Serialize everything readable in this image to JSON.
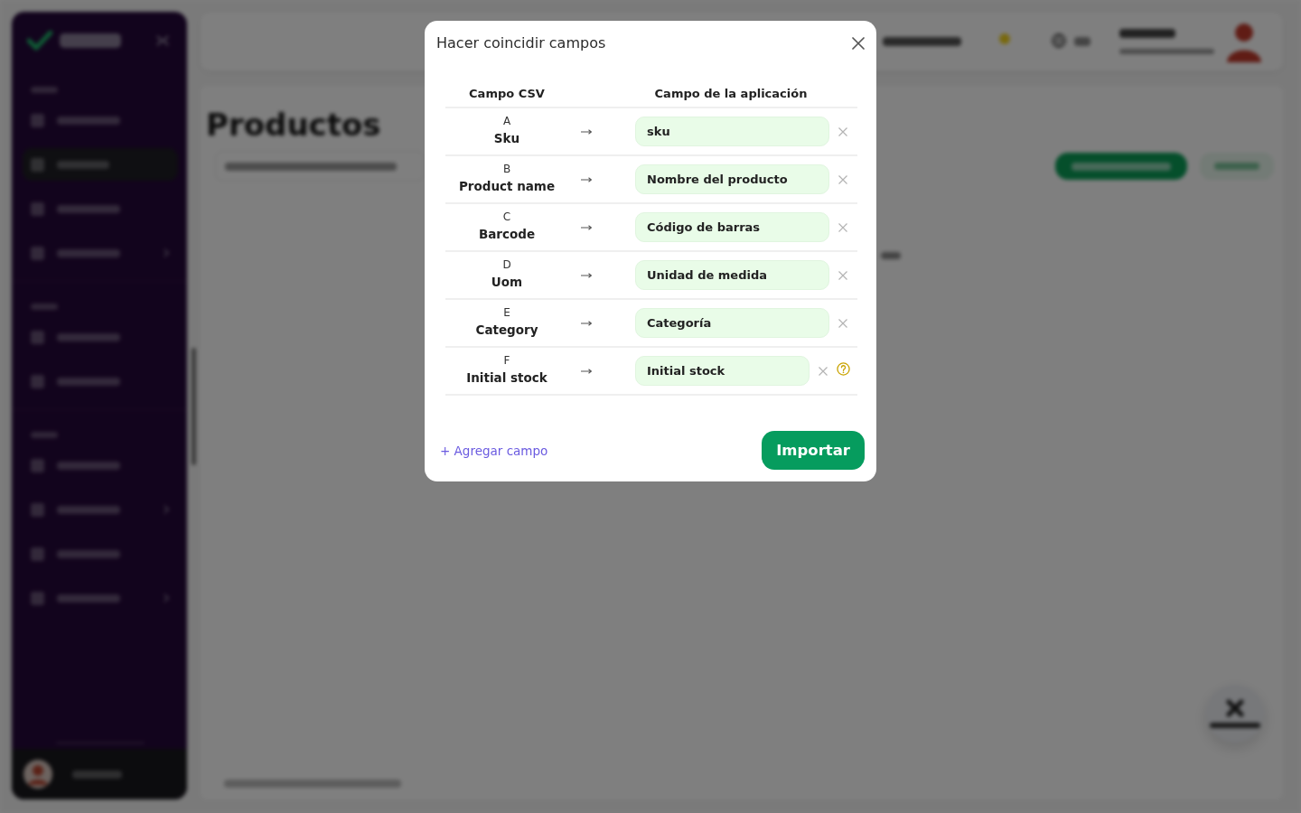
{
  "sidebar": {
    "sections": [
      {
        "items": [
          {
            "selected": false,
            "submenu": false
          },
          {
            "selected": true,
            "submenu": false
          },
          {
            "selected": false,
            "submenu": false
          },
          {
            "selected": false,
            "submenu": true
          }
        ]
      },
      {
        "items": [
          {
            "selected": false,
            "submenu": false
          },
          {
            "selected": false,
            "submenu": false
          }
        ]
      },
      {
        "items": [
          {
            "selected": false,
            "submenu": false
          },
          {
            "selected": false,
            "submenu": true
          },
          {
            "selected": false,
            "submenu": false
          },
          {
            "selected": false,
            "submenu": true
          }
        ]
      }
    ]
  },
  "page": {
    "title": "Productos"
  },
  "dialog": {
    "title": "Hacer coincidir campos",
    "columns": [
      "Campo CSV",
      "Campo de la aplicación"
    ],
    "mappings": [
      {
        "letter": "A",
        "csv_field": "Sku",
        "app_field": "sku",
        "help": false
      },
      {
        "letter": "B",
        "csv_field": "Product name",
        "app_field": "Nombre del producto",
        "help": false
      },
      {
        "letter": "C",
        "csv_field": "Barcode",
        "app_field": "Código de barras",
        "help": false
      },
      {
        "letter": "D",
        "csv_field": "Uom",
        "app_field": "Unidad de medida",
        "help": false
      },
      {
        "letter": "E",
        "csv_field": "Category",
        "app_field": "Categoría",
        "help": false
      },
      {
        "letter": "F",
        "csv_field": "Initial stock",
        "app_field": "Initial stock",
        "help": true
      }
    ],
    "add_link": "+ Agregar campo",
    "import_button": "Importar"
  }
}
